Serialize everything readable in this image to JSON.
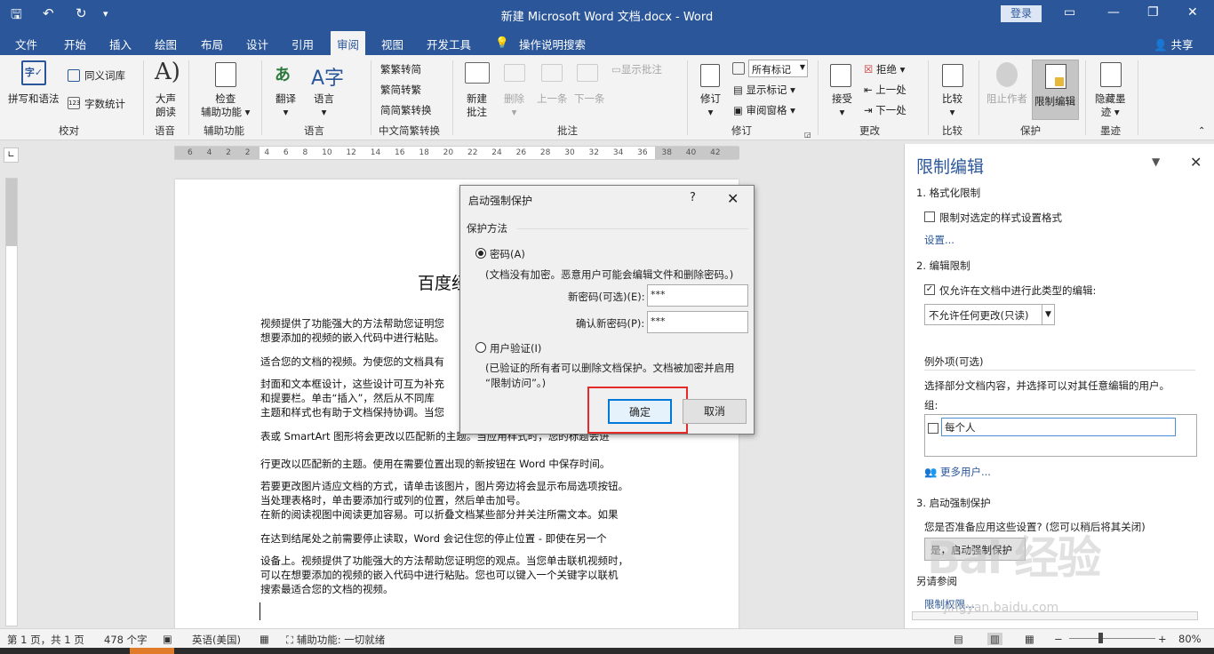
{
  "window": {
    "title": "新建 Microsoft Word 文档.docx - Word",
    "login_label": "登录",
    "minimize_icon": "minimize-icon",
    "restore_icon": "restore-icon",
    "close_icon": "close-icon"
  },
  "quick_access": {
    "save_icon": "save-icon",
    "undo_icon": "undo-icon",
    "redo_icon": "redo-icon",
    "customize_icon": "customize-icon"
  },
  "tabs": [
    {
      "label": "文件"
    },
    {
      "label": "开始"
    },
    {
      "label": "插入"
    },
    {
      "label": "绘图"
    },
    {
      "label": "布局"
    },
    {
      "label": "设计"
    },
    {
      "label": "引用"
    },
    {
      "label": "审阅",
      "active": true
    },
    {
      "label": "视图"
    },
    {
      "label": "开发工具"
    },
    {
      "label": "操作说明搜索"
    }
  ],
  "share_label": "共享",
  "ribbon": {
    "proofing": {
      "spell": "拼写和语法",
      "thesaurus": "同义词库",
      "wordcount": "字数统计",
      "group": "校对"
    },
    "speech": {
      "read_line1": "大声",
      "read_line2": "朗读",
      "group": "语音"
    },
    "accessibility": {
      "check_line1": "检查",
      "check_line2": "辅助功能",
      "group": "辅助功能"
    },
    "language": {
      "translate": "翻译",
      "language": "语言",
      "group": "语言"
    },
    "chinese": {
      "t2s": "繁转简",
      "s2t": "简转繁",
      "convert": "简繁转换",
      "group": "中文简繁转换"
    },
    "comments": {
      "new_line1": "新建",
      "new_line2": "批注",
      "delete": "删除",
      "prev": "上一条",
      "next": "下一条",
      "show": "显示批注",
      "group": "批注"
    },
    "tracking": {
      "track": "修订",
      "markup_select": "所有标记",
      "show_markup": "显示标记",
      "review_pane": "审阅窗格",
      "group": "修订"
    },
    "changes": {
      "accept": "接受",
      "reject": "拒绝",
      "prev": "上一处",
      "next": "下一处",
      "group": "更改"
    },
    "compare": {
      "compare": "比较",
      "group": "比较"
    },
    "protect": {
      "block": "阻止作者",
      "restrict": "限制编辑",
      "group": "保护"
    },
    "ink": {
      "hide_line1": "隐藏墨",
      "hide_line2": "迹",
      "group": "墨迹"
    }
  },
  "ruler": {
    "corner_icon": "tab-stop-icon",
    "numbers": "6 4 2 2 4 6 8 10 12 14 16 18 20 22 24 26 28 30 32 34 36 38 40 42"
  },
  "document": {
    "heading": "百度经",
    "lines": [
      "视频提供了功能强大的方法帮助您证明您",
      "想要添加的视频的嵌入代码中进行粘贴。",
      "适合您的文档的视频。为使您的文档具有",
      "封面和文本框设计，这些设计可互为补充",
      "和提要栏。单击“插入”，然后从不同库",
      "主题和样式也有助于文档保持协调。当您",
      "表或 SmartArt 图形将会更改以匹配新的主题。当应用样式时，您的标题会进",
      "行更改以匹配新的主题。使用在需要位置出现的新按钮在 Word 中保存时间。",
      "若要更改图片适应文档的方式，请单击该图片，图片旁边将会显示布局选项按钮。",
      "当处理表格时，单击要添加行或列的位置，然后单击加号。",
      "在新的阅读视图中阅读更加容易。可以折叠文档某些部分并关注所需文本。如果",
      "在达到结尾处之前需要停止读取，Word 会记住您的停止位置 - 即使在另一个",
      "设备上。视频提供了功能强大的方法帮助您证明您的观点。当您单击联机视频时，",
      "可以在想要添加的视频的嵌入代码中进行粘贴。您也可以键入一个关键字以联机",
      "搜索最适合您的文档的视频。"
    ]
  },
  "dialog": {
    "title": "启动强制保护",
    "help": "?",
    "section": "保护方法",
    "password_label": "密码(A)",
    "password_note": "(文档没有加密。恶意用户可能会编辑文件和删除密码。)",
    "new_password_label": "新密码(可选)(E):",
    "new_password_value": "***",
    "confirm_label": "确认新密码(P):",
    "confirm_value": "***",
    "user_auth_label": "用户验证(I)",
    "user_auth_note1": "(已验证的所有者可以删除文档保护。文档被加密并启用",
    "user_auth_note2": "“限制访问”。)",
    "ok": "确定",
    "cancel": "取消"
  },
  "panel": {
    "title": "限制编辑",
    "s1_title": "1. 格式化限制",
    "s1_check": "限制对选定的样式设置格式",
    "s1_link": "设置...",
    "s2_title": "2. 编辑限制",
    "s2_check": "仅允许在文档中进行此类型的编辑:",
    "s2_select": "不允许任何更改(只读)",
    "exceptions_title": "例外项(可选)",
    "exceptions_desc": "选择部分文档内容，并选择可以对其任意编辑的用户。",
    "groups_label": "组:",
    "everyone": "每个人",
    "more_users": "更多用户...",
    "s3_title": "3. 启动强制保护",
    "s3_desc": "您是否准备应用这些设置? (您可以稍后将其关闭)",
    "s3_button": "是，启动强制保护",
    "also_label": "另请参阅",
    "perm_link": "限制权限..."
  },
  "watermark": {
    "main": "Bai 经验",
    "sub": "jingyan.baidu.com"
  },
  "status": {
    "page": "第 1 页，共 1 页",
    "words": "478 个字",
    "lang": "英语(美国)",
    "access": "辅助功能: 一切就绪",
    "zoom": "80%"
  }
}
